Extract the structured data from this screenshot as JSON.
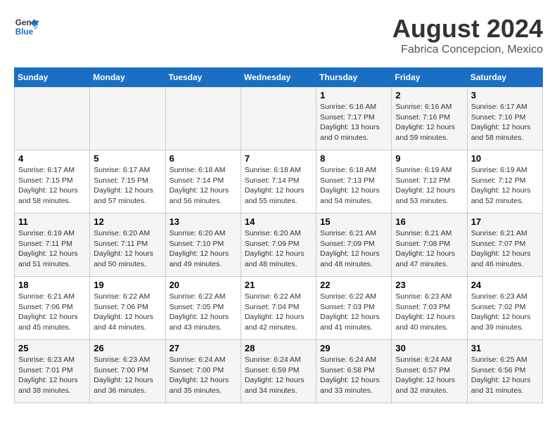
{
  "logo": {
    "line1": "General",
    "line2": "Blue"
  },
  "title": "August 2024",
  "location": "Fabrica Concepcion, Mexico",
  "headers": [
    "Sunday",
    "Monday",
    "Tuesday",
    "Wednesday",
    "Thursday",
    "Friday",
    "Saturday"
  ],
  "weeks": [
    [
      {
        "day": "",
        "info": ""
      },
      {
        "day": "",
        "info": ""
      },
      {
        "day": "",
        "info": ""
      },
      {
        "day": "",
        "info": ""
      },
      {
        "day": "1",
        "info": "Sunrise: 6:16 AM\nSunset: 7:17 PM\nDaylight: 13 hours\nand 0 minutes."
      },
      {
        "day": "2",
        "info": "Sunrise: 6:16 AM\nSunset: 7:16 PM\nDaylight: 12 hours\nand 59 minutes."
      },
      {
        "day": "3",
        "info": "Sunrise: 6:17 AM\nSunset: 7:16 PM\nDaylight: 12 hours\nand 58 minutes."
      }
    ],
    [
      {
        "day": "4",
        "info": "Sunrise: 6:17 AM\nSunset: 7:15 PM\nDaylight: 12 hours\nand 58 minutes."
      },
      {
        "day": "5",
        "info": "Sunrise: 6:17 AM\nSunset: 7:15 PM\nDaylight: 12 hours\nand 57 minutes."
      },
      {
        "day": "6",
        "info": "Sunrise: 6:18 AM\nSunset: 7:14 PM\nDaylight: 12 hours\nand 56 minutes."
      },
      {
        "day": "7",
        "info": "Sunrise: 6:18 AM\nSunset: 7:14 PM\nDaylight: 12 hours\nand 55 minutes."
      },
      {
        "day": "8",
        "info": "Sunrise: 6:18 AM\nSunset: 7:13 PM\nDaylight: 12 hours\nand 54 minutes."
      },
      {
        "day": "9",
        "info": "Sunrise: 6:19 AM\nSunset: 7:12 PM\nDaylight: 12 hours\nand 53 minutes."
      },
      {
        "day": "10",
        "info": "Sunrise: 6:19 AM\nSunset: 7:12 PM\nDaylight: 12 hours\nand 52 minutes."
      }
    ],
    [
      {
        "day": "11",
        "info": "Sunrise: 6:19 AM\nSunset: 7:11 PM\nDaylight: 12 hours\nand 51 minutes."
      },
      {
        "day": "12",
        "info": "Sunrise: 6:20 AM\nSunset: 7:11 PM\nDaylight: 12 hours\nand 50 minutes."
      },
      {
        "day": "13",
        "info": "Sunrise: 6:20 AM\nSunset: 7:10 PM\nDaylight: 12 hours\nand 49 minutes."
      },
      {
        "day": "14",
        "info": "Sunrise: 6:20 AM\nSunset: 7:09 PM\nDaylight: 12 hours\nand 48 minutes."
      },
      {
        "day": "15",
        "info": "Sunrise: 6:21 AM\nSunset: 7:09 PM\nDaylight: 12 hours\nand 48 minutes."
      },
      {
        "day": "16",
        "info": "Sunrise: 6:21 AM\nSunset: 7:08 PM\nDaylight: 12 hours\nand 47 minutes."
      },
      {
        "day": "17",
        "info": "Sunrise: 6:21 AM\nSunset: 7:07 PM\nDaylight: 12 hours\nand 46 minutes."
      }
    ],
    [
      {
        "day": "18",
        "info": "Sunrise: 6:21 AM\nSunset: 7:06 PM\nDaylight: 12 hours\nand 45 minutes."
      },
      {
        "day": "19",
        "info": "Sunrise: 6:22 AM\nSunset: 7:06 PM\nDaylight: 12 hours\nand 44 minutes."
      },
      {
        "day": "20",
        "info": "Sunrise: 6:22 AM\nSunset: 7:05 PM\nDaylight: 12 hours\nand 43 minutes."
      },
      {
        "day": "21",
        "info": "Sunrise: 6:22 AM\nSunset: 7:04 PM\nDaylight: 12 hours\nand 42 minutes."
      },
      {
        "day": "22",
        "info": "Sunrise: 6:22 AM\nSunset: 7:03 PM\nDaylight: 12 hours\nand 41 minutes."
      },
      {
        "day": "23",
        "info": "Sunrise: 6:23 AM\nSunset: 7:03 PM\nDaylight: 12 hours\nand 40 minutes."
      },
      {
        "day": "24",
        "info": "Sunrise: 6:23 AM\nSunset: 7:02 PM\nDaylight: 12 hours\nand 39 minutes."
      }
    ],
    [
      {
        "day": "25",
        "info": "Sunrise: 6:23 AM\nSunset: 7:01 PM\nDaylight: 12 hours\nand 38 minutes."
      },
      {
        "day": "26",
        "info": "Sunrise: 6:23 AM\nSunset: 7:00 PM\nDaylight: 12 hours\nand 36 minutes."
      },
      {
        "day": "27",
        "info": "Sunrise: 6:24 AM\nSunset: 7:00 PM\nDaylight: 12 hours\nand 35 minutes."
      },
      {
        "day": "28",
        "info": "Sunrise: 6:24 AM\nSunset: 6:59 PM\nDaylight: 12 hours\nand 34 minutes."
      },
      {
        "day": "29",
        "info": "Sunrise: 6:24 AM\nSunset: 6:58 PM\nDaylight: 12 hours\nand 33 minutes."
      },
      {
        "day": "30",
        "info": "Sunrise: 6:24 AM\nSunset: 6:57 PM\nDaylight: 12 hours\nand 32 minutes."
      },
      {
        "day": "31",
        "info": "Sunrise: 6:25 AM\nSunset: 6:56 PM\nDaylight: 12 hours\nand 31 minutes."
      }
    ]
  ]
}
